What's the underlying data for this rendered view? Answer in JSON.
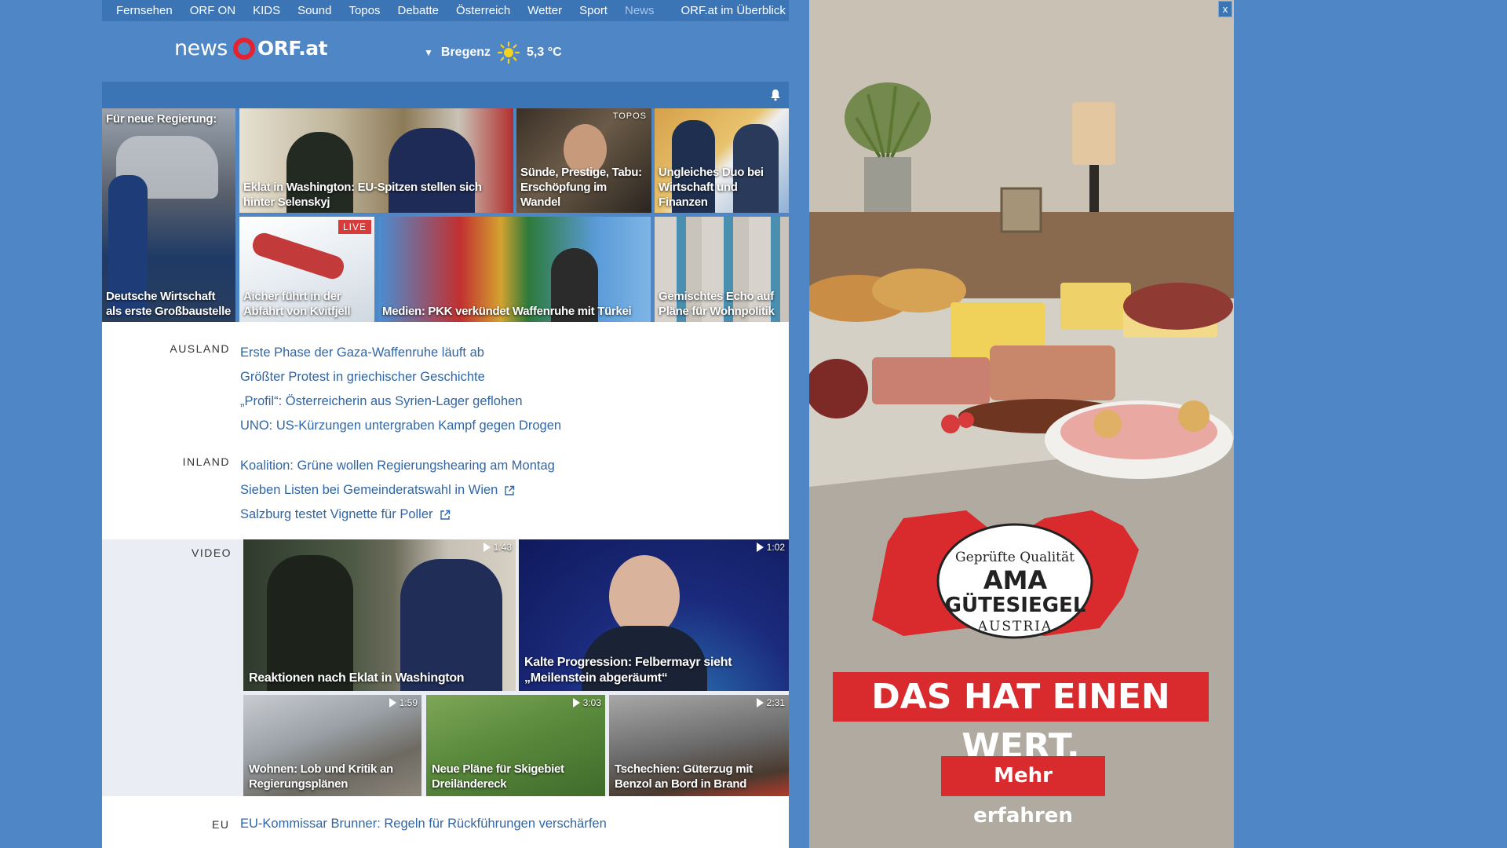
{
  "topnav": {
    "items": [
      "Fernsehen",
      "ORF ON",
      "KIDS",
      "Sound",
      "Topos",
      "Debatte",
      "Österreich",
      "Wetter",
      "Sport",
      "News"
    ],
    "overview": "ORF.at im Überblick"
  },
  "brand": {
    "news": "news",
    "orf": "ORF.at"
  },
  "weather": {
    "location": "Bregenz",
    "temperature": "5,3 °C",
    "icon": "sun-icon"
  },
  "tiles": [
    {
      "title": "Deutsche Wirtschaft als erste Großbaustelle",
      "top_text": "Für neue Regierung:"
    },
    {
      "title": "Eklat in Washington: EU-Spitzen stellen sich hinter Selenskyj"
    },
    {
      "title": "Sünde, Prestige, Tabu: Erschöpfung im Wandel",
      "label": "TOPOS"
    },
    {
      "title": "Ungleiches Duo bei Wirtschaft und Finanzen"
    },
    {
      "title": "Aicher führt in der Abfahrt von Kvitfjell",
      "label": "LIVE"
    },
    {
      "title": "Medien: PKK verkündet Waffenruhe mit Türkei"
    },
    {
      "title": "Gemischtes Echo auf Pläne für Wohnpolitik"
    }
  ],
  "sections": [
    {
      "name": "AUSLAND",
      "links": [
        {
          "text": "Erste Phase der Gaza-Waffenruhe läuft ab",
          "external": false
        },
        {
          "text": "Größter Protest in griechischer Geschichte",
          "external": false
        },
        {
          "text": "„Profil“: Österreicherin aus Syrien-Lager geflohen",
          "external": false
        },
        {
          "text": "UNO: US-Kürzungen untergraben Kampf gegen Drogen",
          "external": false
        }
      ]
    },
    {
      "name": "INLAND",
      "links": [
        {
          "text": "Koalition: Grüne wollen Regierungshearing am Montag",
          "external": false
        },
        {
          "text": "Sieben Listen bei Gemeinderatswahl in Wien",
          "external": true
        },
        {
          "text": "Salzburg testet Vignette für Poller",
          "external": true
        }
      ]
    }
  ],
  "videos": {
    "name": "VIDEO",
    "items": [
      {
        "title": "Reaktionen nach Eklat in Washington",
        "duration": "1:43"
      },
      {
        "title": "Kalte Progression: Felbermayr sieht „Meilenstein abgeräumt“",
        "duration": "1:02"
      },
      {
        "title": "Wohnen: Lob und Kritik an Regierungsplänen",
        "duration": "1:59"
      },
      {
        "title": "Neue Pläne für Skigebiet Dreiländereck",
        "duration": "3:03"
      },
      {
        "title": "Tschechien: Güterzug mit Benzol an Bord in Brand",
        "duration": "2:31"
      }
    ]
  },
  "eu": {
    "name": "EU",
    "link": "EU-Kommissar Brunner: Regeln für Rückführungen verschärfen"
  },
  "ad": {
    "close": "x",
    "seal_top": "Geprüfte Qualität",
    "seal_line1": "AMA",
    "seal_line2": "GÜTESIEGEL",
    "seal_bottom": "AUSTRIA",
    "slogan": "DAS HAT EINEN WERT.",
    "cta": "Mehr erfahren"
  },
  "colors": {
    "page_bg": "#4f86c6",
    "nav_bg": "#3c75b6",
    "link": "#2f66a6",
    "ad_red": "#d92a2e",
    "orf_red": "#e5232f"
  }
}
